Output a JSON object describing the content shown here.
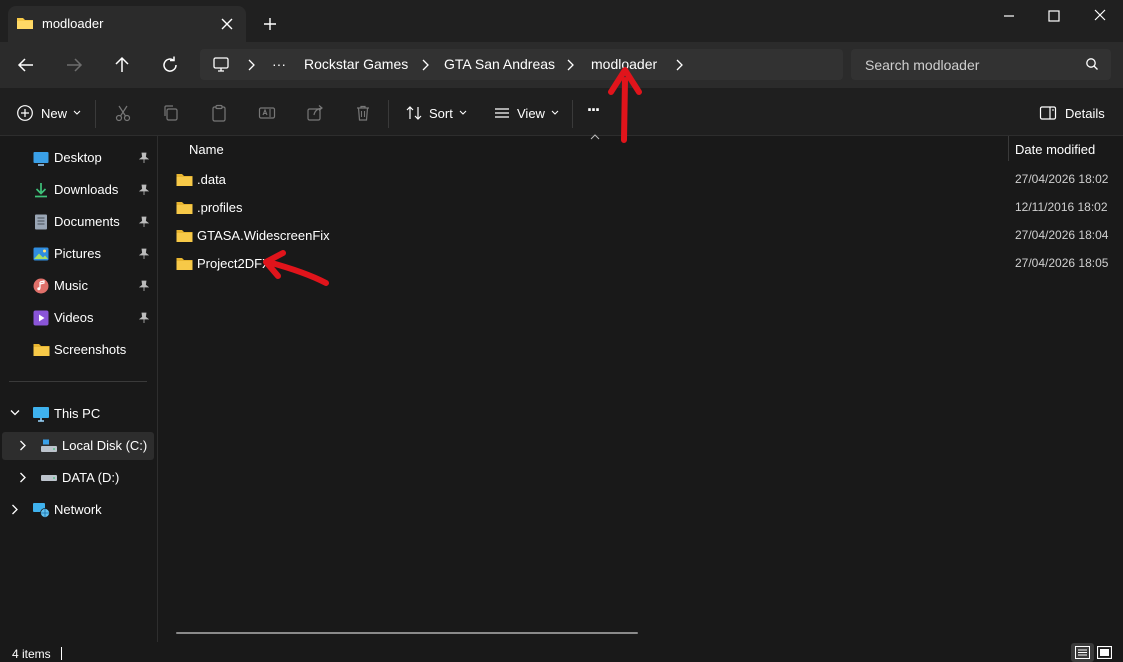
{
  "window": {
    "tab_title": "modloader",
    "new_tab_label": "+"
  },
  "nav": {
    "breadcrumbs": [
      "Rockstar Games",
      "GTA San Andreas",
      "modloader"
    ],
    "overflow": "···",
    "search_placeholder": "Search modloader"
  },
  "commands": {
    "new_label": "New",
    "sort_label": "Sort",
    "view_label": "View",
    "more_label": "···",
    "details_label": "Details"
  },
  "sidebar": {
    "quick_access": [
      {
        "label": "Desktop",
        "icon": "desktop-icon",
        "pinned": true
      },
      {
        "label": "Downloads",
        "icon": "download-icon",
        "pinned": true
      },
      {
        "label": "Documents",
        "icon": "document-icon",
        "pinned": true
      },
      {
        "label": "Pictures",
        "icon": "picture-icon",
        "pinned": true
      },
      {
        "label": "Music",
        "icon": "music-icon",
        "pinned": true
      },
      {
        "label": "Videos",
        "icon": "video-icon",
        "pinned": true
      },
      {
        "label": "Screenshots",
        "icon": "folder-icon",
        "pinned": false
      }
    ],
    "this_pc": "This PC",
    "drives": [
      {
        "label": "Local Disk (C:)",
        "selected": true
      },
      {
        "label": "DATA (D:)",
        "selected": false
      }
    ],
    "network": "Network"
  },
  "list": {
    "columns": [
      "Name",
      "Date modified"
    ],
    "rows": [
      {
        "name": ".data",
        "date": "27/04/2026 18:02"
      },
      {
        "name": ".profiles",
        "date": "12/11/2016 18:02"
      },
      {
        "name": "GTASA.WidescreenFix",
        "date": "27/04/2026 18:04"
      },
      {
        "name": "Project2DFX",
        "date": "27/04/2026 18:05"
      }
    ]
  },
  "status": {
    "item_count": "4 items"
  },
  "colors": {
    "folder": "#f7c948",
    "annotation": "#e0141b",
    "background": "#191919"
  }
}
